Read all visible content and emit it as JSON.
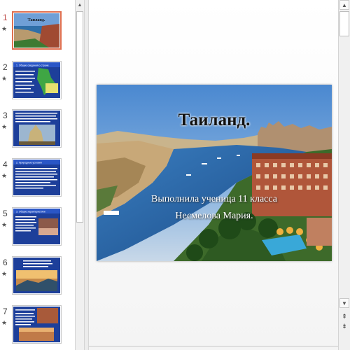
{
  "slides": [
    {
      "number": "1",
      "star": "★",
      "thumb_title": "Таиланд."
    },
    {
      "number": "2",
      "star": "★",
      "thumb_title": "1. Общие сведения о стране"
    },
    {
      "number": "3",
      "star": "★",
      "thumb_title": ""
    },
    {
      "number": "4",
      "star": "★",
      "thumb_title": "2. Природные условия"
    },
    {
      "number": "5",
      "star": "★",
      "thumb_title": "3. Общие характеристики"
    },
    {
      "number": "6",
      "star": "★",
      "thumb_title": ""
    },
    {
      "number": "7",
      "star": "★",
      "thumb_title": ""
    }
  ],
  "current_slide": {
    "title": "Таиланд.",
    "subtitle_line1": "Выполнила ученица 11 класса",
    "subtitle_line2": "Несмелова Мария."
  },
  "scroll": {
    "up": "▲",
    "down": "▼",
    "prev_slide": "⇞",
    "next_slide": "⇟"
  }
}
